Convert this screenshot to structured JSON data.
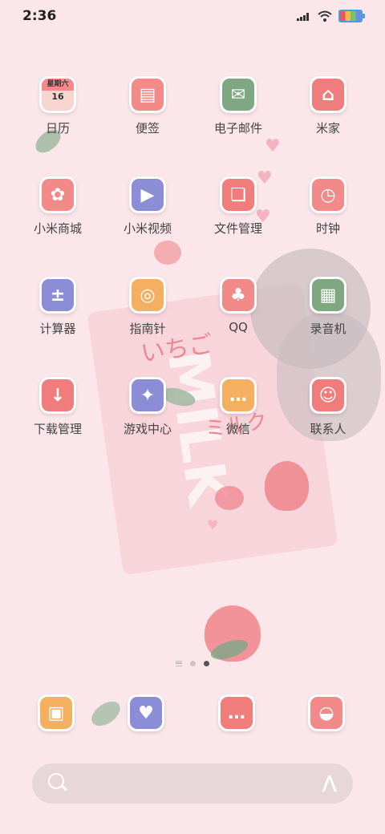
{
  "status_bar": {
    "time": "2:36"
  },
  "apps": [
    {
      "label": "日历",
      "color": "#f7d6d2",
      "glyph": "",
      "cal_weekday": "星期六",
      "cal_day": "16"
    },
    {
      "label": "便签",
      "color": "#f28a8a",
      "glyph": "▤"
    },
    {
      "label": "电子邮件",
      "color": "#7fa882",
      "glyph": "✉"
    },
    {
      "label": "米家",
      "color": "#ef7d7d",
      "glyph": "⌂"
    },
    {
      "label": "小米商城",
      "color": "#f28a8a",
      "glyph": "✿"
    },
    {
      "label": "小米视频",
      "color": "#8b8ed6",
      "glyph": "▶"
    },
    {
      "label": "文件管理",
      "color": "#f07c7c",
      "glyph": "❏"
    },
    {
      "label": "时钟",
      "color": "#f28a8a",
      "glyph": "◷"
    },
    {
      "label": "计算器",
      "color": "#8b8ed6",
      "glyph": "±"
    },
    {
      "label": "指南针",
      "color": "#f4b060",
      "glyph": "◎"
    },
    {
      "label": "QQ",
      "color": "#f28a8a",
      "glyph": "♣"
    },
    {
      "label": "录音机",
      "color": "#7fa882",
      "glyph": "▦"
    },
    {
      "label": "下载管理",
      "color": "#f07c7c",
      "glyph": "↓"
    },
    {
      "label": "游戏中心",
      "color": "#8b8ed6",
      "glyph": "✦"
    },
    {
      "label": "微信",
      "color": "#f4b060",
      "glyph": "…"
    },
    {
      "label": "联系人",
      "color": "#f07c7c",
      "glyph": "☺"
    }
  ],
  "dock": [
    {
      "color": "#f4b060",
      "glyph": "▣"
    },
    {
      "color": "#8b8ed6",
      "glyph": "♥"
    },
    {
      "color": "#f07c7c",
      "glyph": "…"
    },
    {
      "color": "#f28a8a",
      "glyph": "◒"
    }
  ],
  "wallpaper": {
    "milk_text": "MILK",
    "jp_text": "いちご",
    "jp_text2": "ミルク"
  }
}
